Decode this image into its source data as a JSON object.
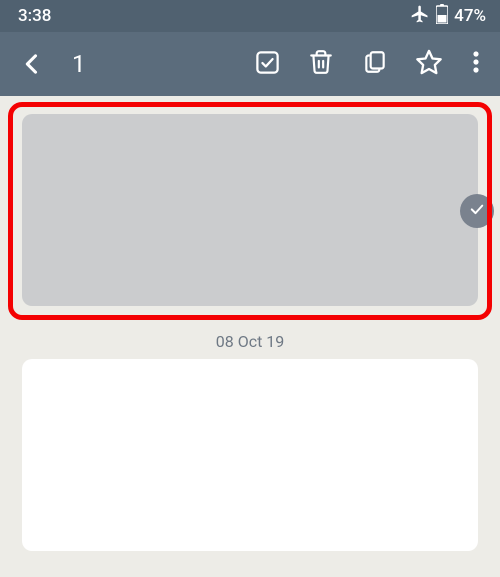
{
  "status": {
    "time": "3:38",
    "battery": "47%"
  },
  "appbar": {
    "selection_count": "1"
  },
  "notes": {
    "date_separator": "08 Oct 19"
  }
}
